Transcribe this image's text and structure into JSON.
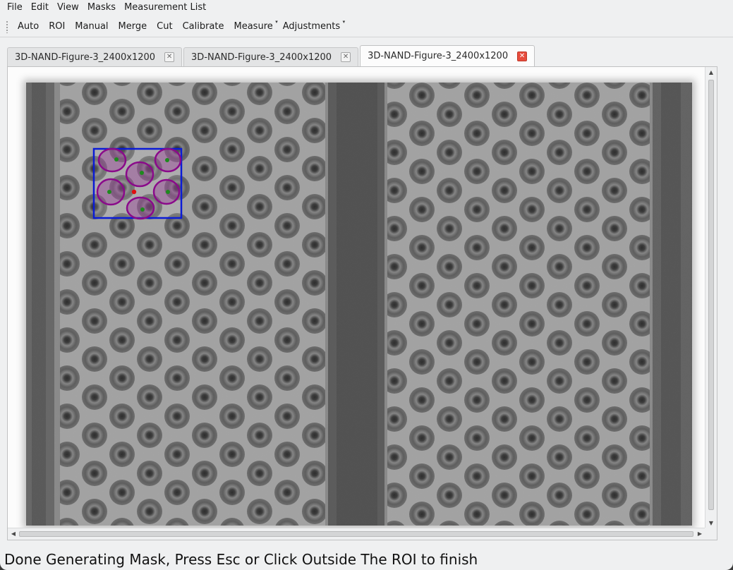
{
  "menubar": {
    "items": [
      "File",
      "Edit",
      "View",
      "Masks",
      "Measurement List"
    ]
  },
  "toolbar": {
    "auto": "Auto",
    "roi": "ROI",
    "manual": "Manual",
    "merge": "Merge",
    "cut": "Cut",
    "calibrate": "Calibrate",
    "measure": "Measure",
    "adjustments": "Adjustments"
  },
  "tabs": [
    {
      "label": "3D-NAND-Figure-3_2400x1200"
    },
    {
      "label": "3D-NAND-Figure-3_2400x1200"
    },
    {
      "label": "3D-NAND-Figure-3_2400x1200"
    }
  ],
  "icons": {
    "close": "close-icon",
    "scroll_up": "scroll-up-arrow-icon",
    "scroll_down": "scroll-down-arrow-icon",
    "scroll_left": "scroll-left-arrow-icon",
    "scroll_right": "scroll-right-arrow-icon"
  },
  "colors": {
    "roi_box": "#0a1bd6",
    "mask_outline": "#8a0a8a",
    "centroid": "#1e8a1e",
    "seed_point": "#e01010",
    "active_tab_close": "#e74c3c"
  },
  "status": {
    "message": "Done Generating Mask, Press Esc or Click Outside The ROI to finish"
  }
}
